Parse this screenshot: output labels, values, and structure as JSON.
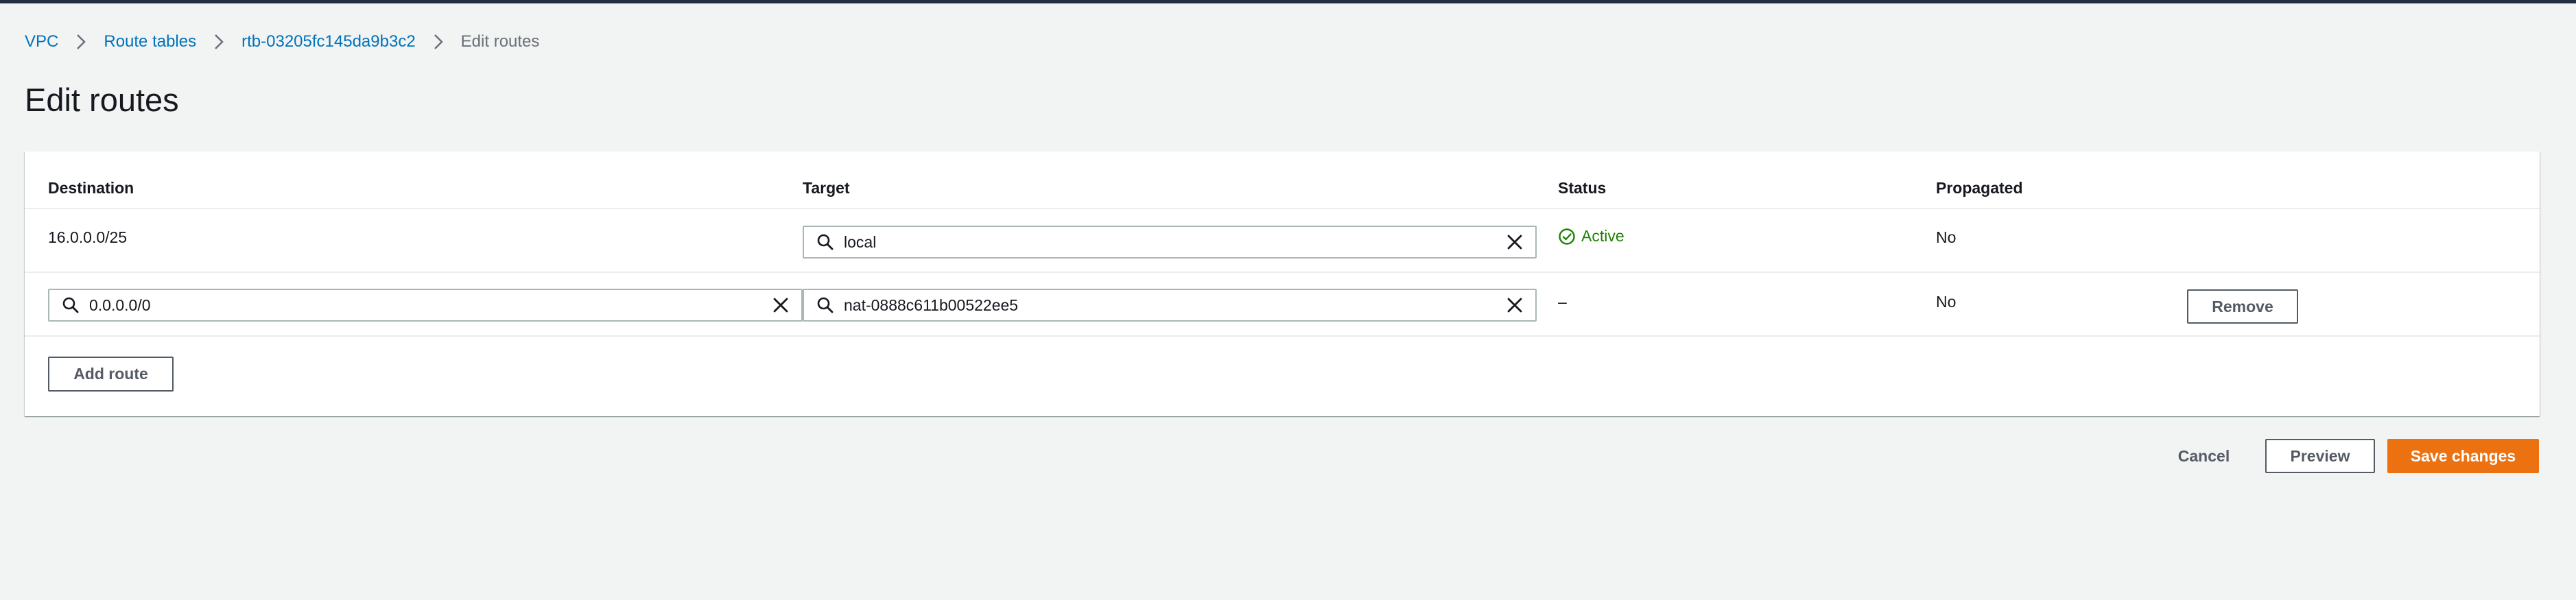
{
  "breadcrumb": {
    "items": [
      "VPC",
      "Route tables",
      "rtb-03205fc145da9b3c2"
    ],
    "current": "Edit routes"
  },
  "page": {
    "title": "Edit routes"
  },
  "table": {
    "headers": {
      "destination": "Destination",
      "target": "Target",
      "status": "Status",
      "propagated": "Propagated"
    },
    "rows": [
      {
        "destination": "16.0.0.0/25",
        "target": "local",
        "status": "Active",
        "propagated": "No"
      },
      {
        "destination": "0.0.0.0/0",
        "target": "nat-0888c611b00522ee5",
        "status": "–",
        "propagated": "No",
        "remove_label": "Remove"
      }
    ],
    "add_route_label": "Add route"
  },
  "footer": {
    "cancel_label": "Cancel",
    "preview_label": "Preview",
    "save_label": "Save changes"
  },
  "icons": {
    "breadcrumb_separator": "chevron-right-icon",
    "field_search": "search-icon",
    "field_clear": "close-icon",
    "status": "check-circle-icon"
  },
  "colors": {
    "background": "#f2f3f3",
    "link": "#0073bb",
    "status_active": "#1d8102",
    "primary_button": "#ec7211",
    "top_bar": "#232f3e"
  }
}
